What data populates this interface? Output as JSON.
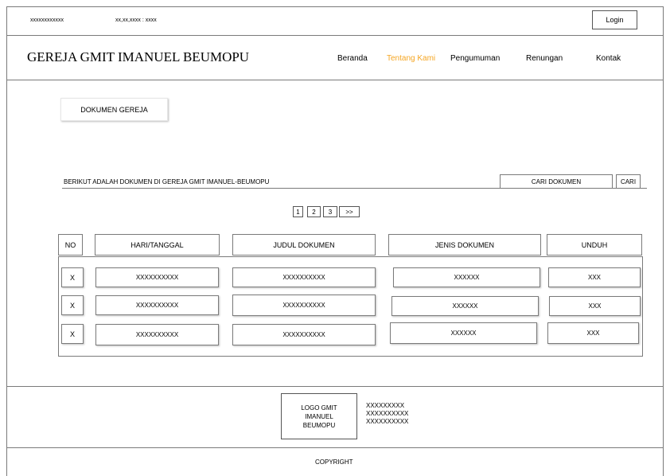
{
  "topbar": {
    "left_text": "xxxxxxxxxxxx",
    "datetime": "xx,xx,xxxx : xxxx",
    "login_label": "Login"
  },
  "header": {
    "site_title": "GEREJA GMIT IMANUEL BEUMOPU",
    "nav": {
      "home": "Beranda",
      "about": "Tentang Kami",
      "announcements": "Pengumuman",
      "devotions": "Renungan",
      "contact": "Kontak"
    },
    "active_color": "#f5a623"
  },
  "main": {
    "section_button": "DOKUMEN GEREJA",
    "description": "BERIKUT ADALAH DOKUMEN DI GEREJA GMIT IMANUEL-BEUMOPU",
    "search_placeholder": "CARI DOKUMEN",
    "search_button": "CARI",
    "pagination": {
      "p1": "1",
      "p2": "2",
      "p3": "3",
      "next": ">>"
    },
    "table": {
      "headers": {
        "no": "NO",
        "date": "HARI/TANGGAL",
        "title": "JUDUL DOKUMEN",
        "type": "JENIS DOKUMEN",
        "download": "UNDUH"
      },
      "rows": [
        {
          "no": "X",
          "date": "XXXXXXXXXX",
          "title": "XXXXXXXXXX",
          "type": "XXXXXX",
          "download": "XXX"
        },
        {
          "no": "X",
          "date": "XXXXXXXXXX",
          "title": "XXXXXXXXXX",
          "type": "XXXXXX",
          "download": "XXX"
        },
        {
          "no": "X",
          "date": "XXXXXXXXXX",
          "title": "XXXXXXXXXX",
          "type": "XXXXXX",
          "download": "XXX"
        }
      ]
    }
  },
  "footer": {
    "logo_line1": "LOGO GMIT",
    "logo_line2": "IMANUEL",
    "logo_line3": "BEUMOPU",
    "info_line1": "XXXXXXXXX",
    "info_line2": "XXXXXXXXXX",
    "info_line3": "XXXXXXXXXX",
    "copyright": "COPYRIGHT"
  }
}
